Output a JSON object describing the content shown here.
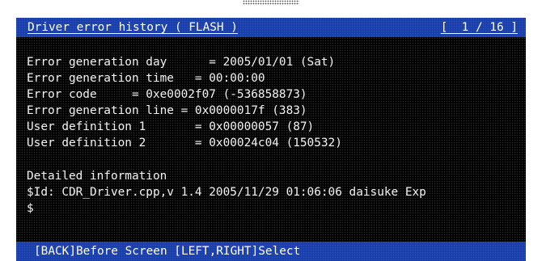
{
  "title_bar": {
    "title": "Driver error history ( FLASH )",
    "page_indicator": "[  1 / 16 ]"
  },
  "error_info": {
    "generation_day": "Error generation day      = 2005/01/01 (Sat)",
    "generation_time": "Error generation time   = 00:00:00",
    "error_code": "Error code     = 0xe0002f07 (-536858873)",
    "generation_line": "Error generation line = 0x0000017f (383)",
    "user_definition_1": "User definition 1       = 0x00000057 (87)",
    "user_definition_2": "User definition 2       = 0x00024c04 (150532)"
  },
  "detail": {
    "heading": "Detailed information",
    "id_line": "$Id: CDR_Driver.cpp,v 1.4 2005/11/29 01:06:06 daisuke Exp",
    "end_line": "$"
  },
  "footer": {
    "hint": "[BACK]Before Screen [LEFT,RIGHT]Select"
  },
  "colors": {
    "bar_background": "#1b3fa8",
    "screen_background": "#000000",
    "text": "#f2f2f2"
  }
}
